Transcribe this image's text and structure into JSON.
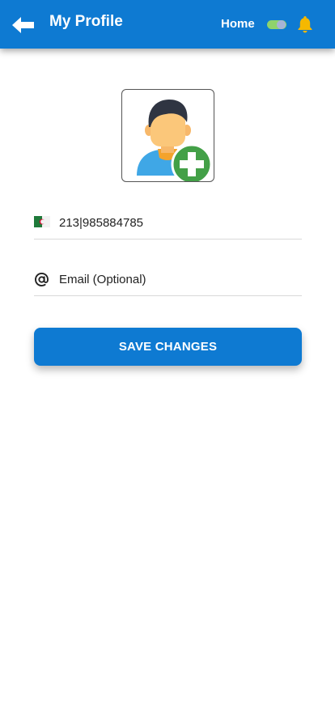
{
  "header": {
    "title": "My Profile",
    "home_label": "Home",
    "background_color": "#0e7ad2",
    "icons": [
      "back-arrow-icon",
      "toggle-switch-icon",
      "bell-icon"
    ]
  },
  "avatar": {
    "icon": "user-avatar-icon",
    "add_icon": "add-plus-icon"
  },
  "form": {
    "phone": {
      "flag_icon": "algeria-flag-icon",
      "value": "213|985884785"
    },
    "email": {
      "icon": "at-sign-icon",
      "placeholder": "Email (Optional)",
      "value": ""
    }
  },
  "actions": {
    "save_label": "SAVE CHANGES"
  },
  "colors": {
    "primary": "#0e7ad2",
    "bell": "#f5b800",
    "add_badge": "#43a047"
  }
}
